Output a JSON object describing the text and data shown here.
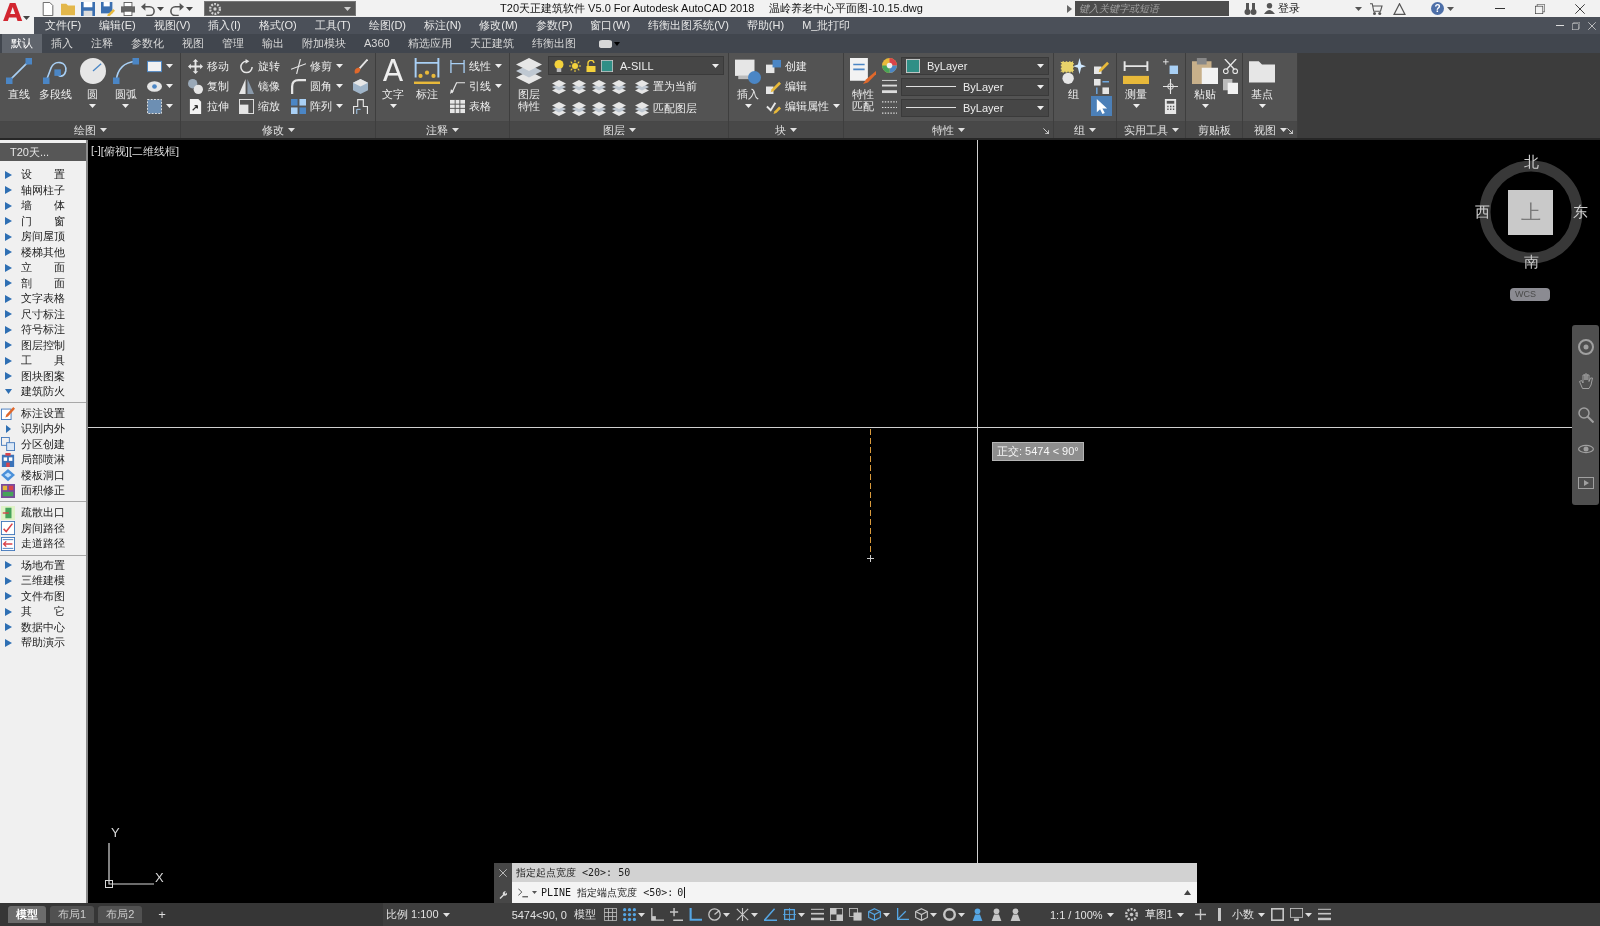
{
  "title_bar": {
    "app_menu": {
      "label": "A",
      "dropdown": true
    },
    "quick_access": [
      {
        "dropdown": false
      },
      {
        "dropdown": false
      },
      {
        "dropdown": false
      },
      {
        "dropdown": false
      },
      {
        "dropdown": false
      },
      {
        "dropdown": true
      },
      {
        "dropdown": true
      }
    ],
    "workspace": {
      "dropdown": true
    },
    "title": "T20天正建筑软件 V5.0 For Autodesk AutoCAD 2018",
    "file_name": "温岭养老中心平面图-10.15.dwg",
    "search": {
      "placeholder": "键入关键字或短语"
    },
    "user": {
      "label": "登录",
      "dropdown": true
    },
    "help": {
      "label": "?",
      "dropdown": true
    }
  },
  "menu_bar": {
    "items": [
      "文件(F)",
      "编辑(E)",
      "视图(V)",
      "插入(I)",
      "格式(O)",
      "工具(T)",
      "绘图(D)",
      "标注(N)",
      "修改(M)",
      "参数(P)",
      "窗口(W)",
      "纬衡出图系统(V)",
      "帮助(H)",
      "M_批打印"
    ]
  },
  "ribbon": {
    "tabs": [
      {
        "label": "默认",
        "selected": true
      },
      {
        "label": "插入",
        "selected": false
      },
      {
        "label": "注释",
        "selected": false
      },
      {
        "label": "参数化",
        "selected": false
      },
      {
        "label": "视图",
        "selected": false
      },
      {
        "label": "管理",
        "selected": false
      },
      {
        "label": "输出",
        "selected": false
      },
      {
        "label": "附加模块",
        "selected": false
      },
      {
        "label": "A360",
        "selected": false
      },
      {
        "label": "精选应用",
        "selected": false
      },
      {
        "label": "天正建筑",
        "selected": false
      },
      {
        "label": "纬衡出图",
        "selected": false
      }
    ],
    "panels": [
      {
        "title": "绘图",
        "menu": true,
        "launcher": false,
        "columns": [
          {
            "kind": "large",
            "label": "直线",
            "dropdown": false
          },
          {
            "kind": "large",
            "label": "多段线",
            "dropdown": false
          },
          {
            "kind": "large",
            "label": "圆",
            "dropdown": true
          },
          {
            "kind": "large",
            "label": "圆弧",
            "dropdown": true
          },
          {
            "kind": "stack",
            "items": [
              {
                "dropdown": true
              },
              {
                "dropdown": true
              },
              {
                "dropdown": true
              }
            ]
          }
        ]
      },
      {
        "title": "修改",
        "menu": true,
        "launcher": false,
        "columns": [
          {
            "kind": "stack",
            "items": [
              {
                "label": "移动",
                "dropdown": false
              },
              {
                "label": "复制",
                "dropdown": false
              },
              {
                "label": "拉伸",
                "dropdown": false
              }
            ]
          },
          {
            "kind": "stack",
            "items": [
              {
                "label": "旋转",
                "dropdown": false
              },
              {
                "label": "镜像",
                "dropdown": false
              },
              {
                "label": "缩放",
                "dropdown": false
              }
            ]
          },
          {
            "kind": "stack",
            "items": [
              {
                "label": "修剪",
                "dropdown": true
              },
              {
                "label": "圆角",
                "dropdown": true
              },
              {
                "label": "阵列",
                "dropdown": true
              }
            ]
          },
          {
            "kind": "stack",
            "items": [
              {
                "dropdown": false
              },
              {
                "dropdown": false
              },
              {
                "dropdown": false
              }
            ]
          }
        ]
      },
      {
        "title": "注释",
        "menu": true,
        "launcher": false,
        "columns": [
          {
            "kind": "large",
            "label": "文字",
            "glyph": "A",
            "dropdown": true
          },
          {
            "kind": "large",
            "label": "标注",
            "dropdown": false
          },
          {
            "kind": "stack",
            "items": [
              {
                "label": "线性",
                "dropdown": true
              },
              {
                "label": "引线",
                "dropdown": true
              },
              {
                "label": "表格",
                "dropdown": false
              }
            ]
          }
        ]
      },
      {
        "title": "图层",
        "menu": true,
        "launcher": false,
        "columns": [
          {
            "kind": "large",
            "label": "图层特性",
            "dropdown": false
          },
          {
            "kind": "layers",
            "layer": "A-SILL",
            "rows": [
              {
                "label": "置为当前"
              },
              {
                "label": "匹配图层"
              }
            ]
          }
        ]
      },
      {
        "title": "块",
        "menu": true,
        "launcher": false,
        "columns": [
          {
            "kind": "large",
            "label": "插入",
            "dropdown": true
          },
          {
            "kind": "stack",
            "items": [
              {
                "label": "创建",
                "dropdown": false
              },
              {
                "label": "编辑",
                "dropdown": false
              },
              {
                "label": "编辑属性",
                "dropdown": true
              }
            ]
          }
        ]
      },
      {
        "title": "特性",
        "menu": true,
        "launcher": true,
        "columns": [
          {
            "kind": "large",
            "label": "特性匹配",
            "dropdown": false
          },
          {
            "kind": "properties",
            "rows": [
              {
                "kind": "color",
                "value": "ByLayer"
              },
              {
                "kind": "lineweight",
                "value": "ByLayer"
              },
              {
                "kind": "linetype",
                "value": "ByLayer"
              }
            ]
          }
        ]
      },
      {
        "title": "组",
        "menu": true,
        "launcher": false,
        "columns": [
          {
            "kind": "large",
            "label": "组",
            "dropdown": false
          },
          {
            "kind": "stack",
            "items": [
              {
                "dropdown": false,
                "on": false
              },
              {
                "dropdown": false,
                "on": false
              },
              {
                "dropdown": false,
                "on": true
              }
            ]
          }
        ]
      },
      {
        "title": "实用工具",
        "menu": true,
        "launcher": false,
        "columns": [
          {
            "kind": "large",
            "label": "测量",
            "dropdown": true
          },
          {
            "kind": "stack",
            "items": [
              {
                "dropdown": false
              },
              {
                "dropdown": false
              },
              {
                "dropdown": false
              }
            ]
          }
        ]
      },
      {
        "title": "剪贴板",
        "menu": false,
        "launcher": false,
        "columns": [
          {
            "kind": "large",
            "label": "粘贴",
            "dropdown": true
          },
          {
            "kind": "stack",
            "items": [
              {
                "dropdown": false
              },
              {
                "dropdown": false
              }
            ]
          }
        ]
      },
      {
        "title": "视图",
        "menu": true,
        "launcher": true,
        "columns": [
          {
            "kind": "large",
            "label": "基点",
            "dropdown": true
          }
        ]
      }
    ]
  },
  "tool_palette": {
    "title": "T20天...",
    "items": [
      {
        "label": "设　　置",
        "expanded": false
      },
      {
        "label": "轴网柱子",
        "expanded": false
      },
      {
        "label": "墙　　体",
        "expanded": false
      },
      {
        "label": "门　　窗",
        "expanded": false
      },
      {
        "label": "房间屋顶",
        "expanded": false
      },
      {
        "label": "楼梯其他",
        "expanded": false
      },
      {
        "label": "立　　面",
        "expanded": false
      },
      {
        "label": "剖　　面",
        "expanded": false
      },
      {
        "label": "文字表格",
        "expanded": false
      },
      {
        "label": "尺寸标注",
        "expanded": false
      },
      {
        "label": "符号标注",
        "expanded": false
      },
      {
        "label": "图层控制",
        "expanded": false
      },
      {
        "label": "工　　具",
        "expanded": false
      },
      {
        "label": "图块图案",
        "expanded": false
      },
      {
        "label": "建筑防火",
        "expanded": true,
        "children": [
          {
            "kind": "command",
            "label": "标注设置",
            "divider_above": false
          },
          {
            "kind": "folder",
            "label": "识别内外",
            "expanded": false,
            "divider_above": false
          },
          {
            "kind": "command",
            "label": "分区创建",
            "divider_above": false
          },
          {
            "kind": "command",
            "label": "局部喷淋",
            "divider_above": false
          },
          {
            "kind": "command",
            "label": "楼板洞口",
            "divider_above": false
          },
          {
            "kind": "command",
            "label": "面积修正",
            "divider_above": false
          },
          {
            "kind": "command",
            "label": "疏散出口",
            "divider_above": true
          },
          {
            "kind": "command",
            "label": "房间路径",
            "divider_above": false
          },
          {
            "kind": "command",
            "label": "走道路径",
            "divider_above": false
          }
        ]
      },
      {
        "label": "场地布置",
        "expanded": false
      },
      {
        "label": "三维建模",
        "expanded": false
      },
      {
        "label": "文件布图",
        "expanded": false
      },
      {
        "label": "其　　它",
        "expanded": false
      },
      {
        "label": "数据中心",
        "expanded": false
      },
      {
        "label": "帮助演示",
        "expanded": false
      }
    ]
  },
  "viewport": {
    "controls": [
      {
        "label": "[-]"
      },
      {
        "label": "[俯视]"
      },
      {
        "label": "[二维线框]"
      }
    ],
    "tooltip": "正交: 5474 < 90°",
    "view_cube": {
      "north": "北",
      "south": "南",
      "west": "西",
      "east": "东",
      "face": "上",
      "coordinate_system": "WCS"
    },
    "ucs": {
      "x_label": "X",
      "y_label": "Y"
    }
  },
  "command_line": {
    "history": "指定起点宽度 <20>: 50",
    "prompt": "PLINE 指定端点宽度 <50>:",
    "value": "0"
  },
  "status_bar": {
    "layout_tabs": [
      {
        "label": "模型",
        "selected": true
      },
      {
        "label": "布局1",
        "selected": false
      },
      {
        "label": "布局2",
        "selected": false
      }
    ],
    "add_tab": "+",
    "scale": {
      "label": "比例 1:100",
      "dropdown": true
    },
    "coordinates": "5474<90, 0",
    "space": "模型",
    "toggles": [
      {
        "on": false,
        "dropdown": false
      },
      {
        "on": true,
        "dropdown": true
      },
      {
        "on": false,
        "dropdown": false
      },
      {
        "on": false,
        "dropdown": false
      },
      {
        "on": true,
        "dropdown": false
      },
      {
        "on": false,
        "dropdown": true
      },
      {
        "on": false,
        "dropdown": true
      },
      {
        "on": true,
        "dropdown": false
      },
      {
        "on": true,
        "dropdown": true
      },
      {
        "on": false,
        "dropdown": false
      },
      {
        "on": false,
        "dropdown": false
      },
      {
        "on": false,
        "dropdown": false
      },
      {
        "on": true,
        "dropdown": true
      },
      {
        "on": true,
        "dropdown": false
      },
      {
        "on": false,
        "dropdown": true
      },
      {
        "on": false,
        "dropdown": true
      },
      {
        "on": true,
        "dropdown": false
      },
      {
        "on": false,
        "dropdown": false
      },
      {
        "on": false,
        "dropdown": false
      }
    ],
    "annotation_scale": {
      "label": "1:1 / 100%",
      "dropdown": true
    },
    "workspace": {
      "label": "草图1",
      "dropdown": true
    },
    "units": {
      "label": "小数",
      "dropdown": true
    },
    "tail_toggles": [
      {
        "on": false,
        "dropdown": false
      },
      {
        "on": false,
        "dropdown": true
      },
      {
        "on": false,
        "dropdown": false
      }
    ]
  }
}
